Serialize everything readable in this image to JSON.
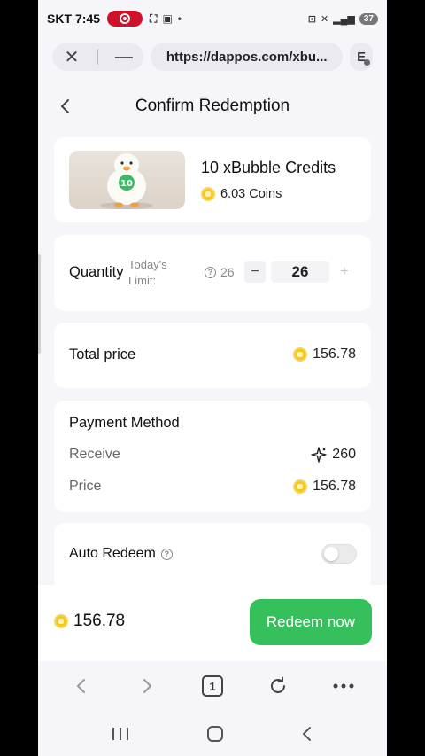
{
  "status_bar": {
    "carrier": "SKT",
    "time": "7:45",
    "battery": "37"
  },
  "browser": {
    "url": "https://dappos.com/xbu...",
    "account_initial": "E",
    "tab_count": "1"
  },
  "page": {
    "title": "Confirm Redemption"
  },
  "product": {
    "name": "10 xBubble Credits",
    "price": "6.03 Coins",
    "image_badge": "10"
  },
  "quantity": {
    "label": "Quantity",
    "limit_label": "Today's Limit:",
    "limit_value": "26",
    "value": "26",
    "minus": "−",
    "plus": "+"
  },
  "total": {
    "label": "Total price",
    "value": "156.78"
  },
  "payment": {
    "title": "Payment Method",
    "receive_label": "Receive",
    "receive_value": "260",
    "price_label": "Price",
    "price_value": "156.78"
  },
  "auto_redeem": {
    "label": "Auto Redeem",
    "enabled": false
  },
  "footer": {
    "price": "156.78",
    "button_label": "Redeem now"
  },
  "colors": {
    "accent_green": "#36c05c",
    "coin_yellow": "#f7c61d",
    "background": "#f6f5fa"
  }
}
